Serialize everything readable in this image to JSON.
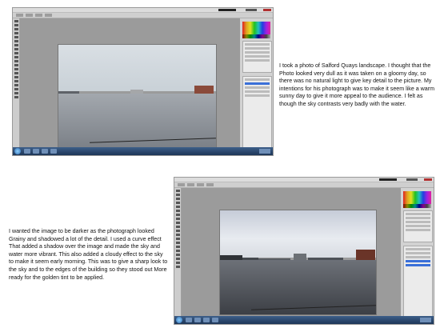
{
  "slides": [
    {
      "caption": "I took a photo of Salford Quays landscape. I thought that the Photo looked very dull as it was taken on a gloomy day, so there was no natural light to give key detail to the picture. My intentions for his photograph was to make it seem like a warm sunny day to give it more appeal to the audience. I felt as though the sky contrasts very badly with the water.",
      "screenshot": {
        "app": "photo-editor",
        "photo": "salford-quays-original",
        "selected_layer_index": 1
      }
    },
    {
      "caption": "I wanted the image to be darker as the photograph looked Grainy and shadowed a lot of the detail. I used a curve effect That added a shadow over the image and made the sky and water more vibrant. This also added a cloudy effect to the sky to make it seem early morning.  This was to give a sharp look to the sky and to the edges of the building so they stood out More ready for the golden tint to be applied.",
      "screenshot": {
        "app": "photo-editor",
        "photo": "salford-quays-edited",
        "selected_layer_index": 3
      }
    }
  ],
  "colors": {
    "page_background": "#ffffff",
    "workspace_gray": "#9b9b9b",
    "taskbar_blue": "#2a4a72",
    "selection_blue": "#3a6fd8"
  }
}
